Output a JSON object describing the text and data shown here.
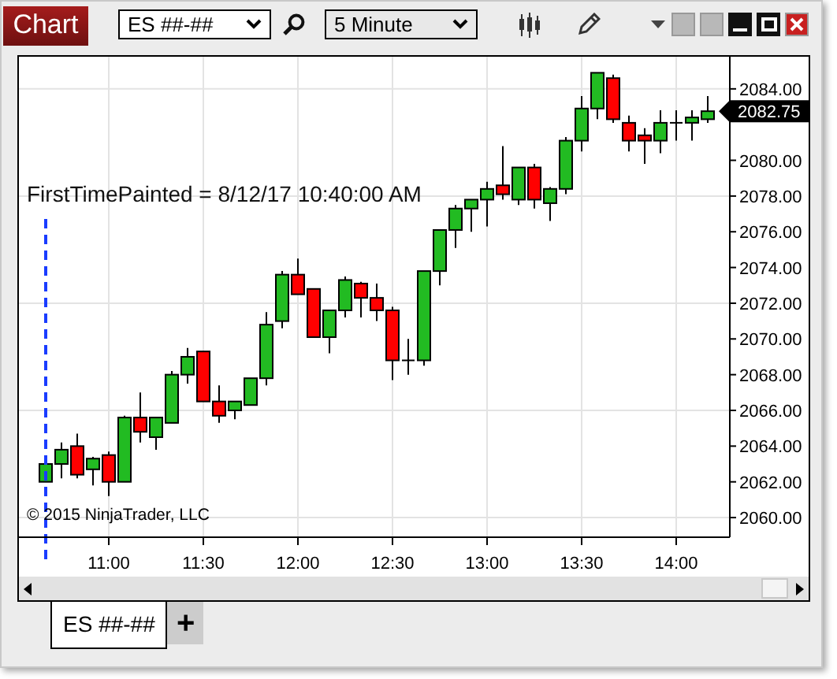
{
  "window": {
    "title": "Chart"
  },
  "toolbar": {
    "instrument": "ES ##-##",
    "interval": "5 Minute"
  },
  "chart": {
    "chart_data": {
      "type": "candlestick",
      "grid": true,
      "ylim": [
        2058.9,
        2085.8
      ],
      "categories": [
        null,
        null,
        null,
        null,
        "11:00",
        null,
        null,
        null,
        null,
        null,
        "11:30",
        null,
        null,
        null,
        null,
        null,
        "12:00",
        null,
        null,
        null,
        null,
        null,
        "12:30",
        null,
        null,
        null,
        null,
        null,
        "13:00",
        null,
        null,
        null,
        null,
        null,
        "13:30",
        null,
        null,
        null,
        null,
        null,
        "14:00",
        null,
        null
      ],
      "yticks": [
        {
          "value": 2060,
          "label": "2060.00"
        },
        {
          "value": 2062,
          "label": "2062.00"
        },
        {
          "value": 2064,
          "label": "2064.00"
        },
        {
          "value": 2066,
          "label": "2066.00"
        },
        {
          "value": 2068,
          "label": "2068.00"
        },
        {
          "value": 2070,
          "label": "2070.00"
        },
        {
          "value": 2072,
          "label": "2072.00"
        },
        {
          "value": 2074,
          "label": "2074.00"
        },
        {
          "value": 2076,
          "label": "2076.00"
        },
        {
          "value": 2078,
          "label": "2078.00"
        },
        {
          "value": 2080,
          "label": "2080.00"
        },
        {
          "value": 2084,
          "label": "2084.00"
        }
      ],
      "ohlc": [
        [
          2062,
          2063.2,
          2062,
          2063
        ],
        [
          2063,
          2064.2,
          2062.2,
          2063.8
        ],
        [
          2064,
          2064.7,
          2062.2,
          2062.4
        ],
        [
          2062.7,
          2063.4,
          2061.8,
          2063.3
        ],
        [
          2063.5,
          2063.7,
          2061.2,
          2062
        ],
        [
          2062,
          2065.7,
          2062,
          2065.6
        ],
        [
          2065.6,
          2067,
          2064.2,
          2064.8
        ],
        [
          2064.5,
          2065.6,
          2063.8,
          2065.6
        ],
        [
          2065.3,
          2068.2,
          2065.3,
          2068
        ],
        [
          2068,
          2069.5,
          2067.5,
          2069
        ],
        [
          2069.3,
          2069.3,
          2066.5,
          2066.5
        ],
        [
          2066.5,
          2067.4,
          2065.3,
          2065.7
        ],
        [
          2066,
          2066.5,
          2065.5,
          2066.5
        ],
        [
          2066.3,
          2067.8,
          2066.3,
          2067.8
        ],
        [
          2067.8,
          2071.5,
          2067.4,
          2070.8
        ],
        [
          2071,
          2073.8,
          2070.6,
          2073.6
        ],
        [
          2073.6,
          2074.5,
          2072.5,
          2072.5
        ],
        [
          2072.8,
          2072.8,
          2070.1,
          2070.1
        ],
        [
          2070.1,
          2071.6,
          2069.2,
          2071.6
        ],
        [
          2071.6,
          2073.5,
          2071.2,
          2073.3
        ],
        [
          2073.1,
          2073.2,
          2071.2,
          2072.3
        ],
        [
          2072.3,
          2073.1,
          2071,
          2071.6
        ],
        [
          2071.6,
          2071.8,
          2067.7,
          2068.8
        ],
        [
          2068.8,
          2070,
          2068,
          2068.8
        ],
        [
          2068.8,
          2073.8,
          2068.5,
          2073.8
        ],
        [
          2073.8,
          2076.1,
          2073,
          2076.1
        ],
        [
          2076.1,
          2077.5,
          2075.1,
          2077.3
        ],
        [
          2077.3,
          2077.8,
          2076,
          2077.8
        ],
        [
          2077.8,
          2078.8,
          2076.3,
          2078.4
        ],
        [
          2078.6,
          2080.8,
          2077.8,
          2078.1
        ],
        [
          2077.8,
          2079.6,
          2077.5,
          2079.6
        ],
        [
          2079.6,
          2079.8,
          2077.3,
          2077.8
        ],
        [
          2077.6,
          2078.5,
          2076.6,
          2078.4
        ],
        [
          2078.4,
          2081.3,
          2078.1,
          2081.1
        ],
        [
          2081.1,
          2083.6,
          2080.5,
          2082.9
        ],
        [
          2082.9,
          2084.9,
          2082.3,
          2084.9
        ],
        [
          2084.6,
          2084.8,
          2082.1,
          2082.3
        ],
        [
          2082.1,
          2082.5,
          2080.5,
          2081.1
        ],
        [
          2081.4,
          2081.8,
          2079.8,
          2081.1
        ],
        [
          2081.1,
          2082.8,
          2080.4,
          2082.1
        ],
        [
          2082.1,
          2082.8,
          2081.1,
          2082.1
        ],
        [
          2082.1,
          2082.8,
          2081.1,
          2082.4
        ],
        [
          2082.3,
          2083.6,
          2082.1,
          2082.75
        ]
      ]
    },
    "annotation_label": "FirstTimePainted = 8/12/17 10:40:00 AM",
    "last_price": "2082.75",
    "copyright": "© 2015 NinjaTrader, LLC"
  },
  "tabs": [
    {
      "label": "ES ##-##",
      "selected": true
    }
  ],
  "add_tab": "+"
}
